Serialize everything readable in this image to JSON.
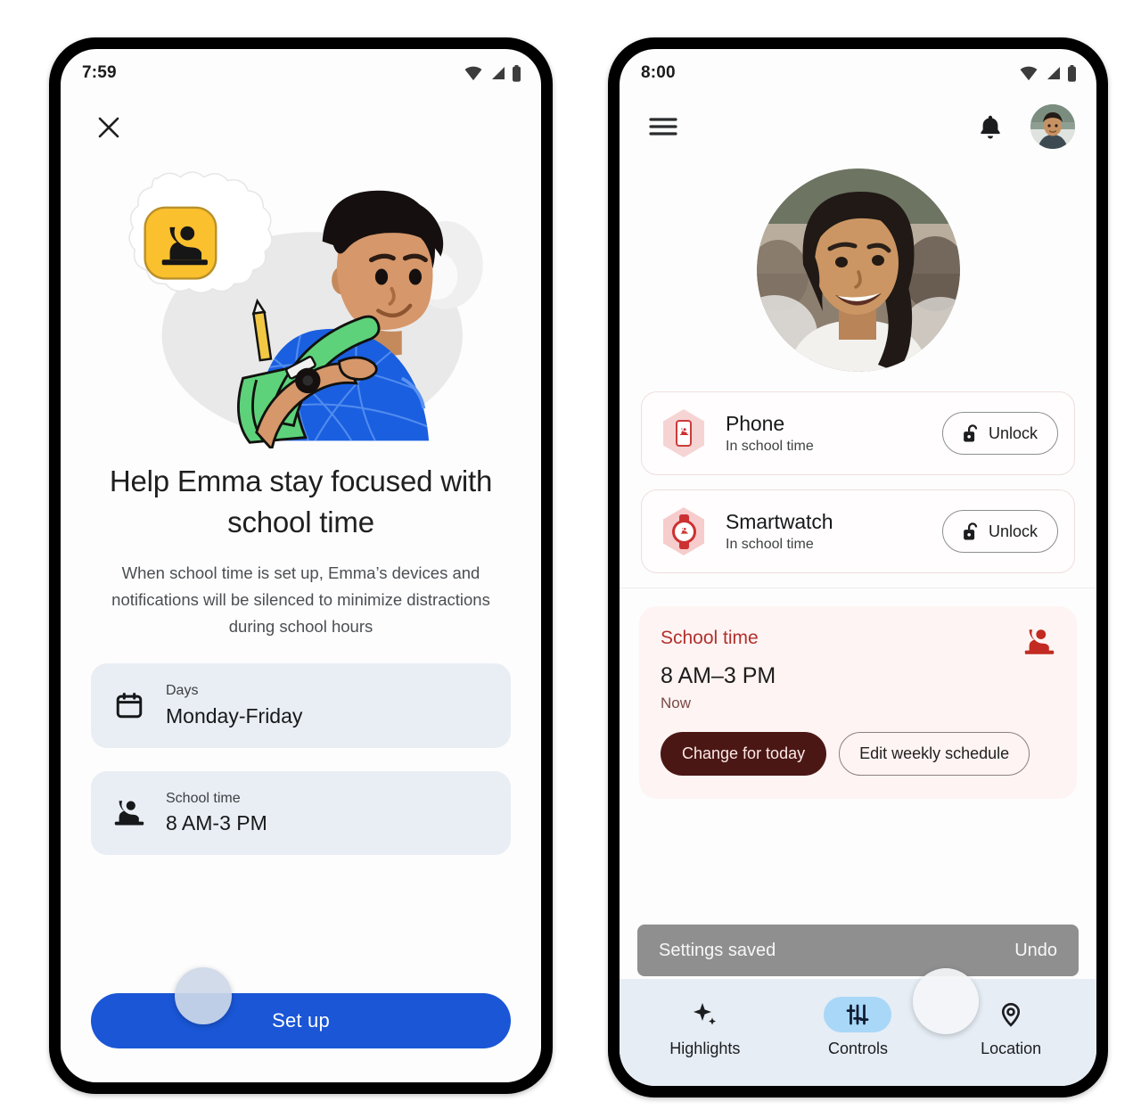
{
  "left_phone": {
    "status_bar": {
      "time": "7:59",
      "icons": [
        "wifi-icon",
        "cellular-signal-icon",
        "battery-icon"
      ]
    },
    "close_icon": "close-icon",
    "illustration": {
      "name": "student-with-backpack-illustration",
      "thought_bubble_icon": "school-time-icon",
      "alt": "Boy with green backpack thinking about school time"
    },
    "title": "Help Emma stay focused with school time",
    "subtitle": "When school time is set up, Emma’s devices and notifications will be silenced to minimize distractions during school hours",
    "rows": [
      {
        "icon": "calendar-icon",
        "label": "Days",
        "value": "Monday-Friday"
      },
      {
        "icon": "school-time-icon",
        "label": "School time",
        "value": "8 AM-3 PM"
      }
    ],
    "primary_button": "Set up"
  },
  "right_phone": {
    "status_bar": {
      "time": "8:00",
      "icons": [
        "wifi-icon",
        "cellular-signal-icon",
        "battery-icon"
      ]
    },
    "top_bar": {
      "menu_icon": "hamburger-menu-icon",
      "notification_icon": "bell-icon",
      "account_avatar": "parent-account-avatar"
    },
    "child_avatar": "child-profile-photo",
    "devices": [
      {
        "icon": "phone-school-time-hexagon-icon",
        "name": "Phone",
        "status": "In school time",
        "action_label": "Unlock",
        "action_icon": "unlock-icon"
      },
      {
        "icon": "smartwatch-school-time-hexagon-icon",
        "name": "Smartwatch",
        "status": "In school time",
        "action_label": "Unlock",
        "action_icon": "unlock-icon"
      }
    ],
    "school_time_card": {
      "heading": "School time",
      "icon": "school-time-icon",
      "time_range": "8 AM–3 PM",
      "state": "Now",
      "primary_action": "Change for today",
      "secondary_action": "Edit weekly schedule"
    },
    "snackbar": {
      "message": "Settings saved",
      "action": "Undo"
    },
    "bottom_nav": [
      {
        "icon": "sparkle-icon",
        "label": "Highlights",
        "active": false
      },
      {
        "icon": "tune-sliders-icon",
        "label": "Controls",
        "active": true
      },
      {
        "icon": "location-pin-icon",
        "label": "Location",
        "active": false
      }
    ]
  },
  "colors": {
    "primary_blue": "#1a56d6",
    "row_card_bg": "#e9eef4",
    "school_time_red": "#b3302c",
    "school_time_card_bg": "#fdf4f3",
    "dark_brown_button": "#4b1715",
    "nav_active_pill": "#a9d7f7",
    "snackbar_bg": "#908f8f",
    "bottom_nav_bg": "#e6edf5"
  }
}
